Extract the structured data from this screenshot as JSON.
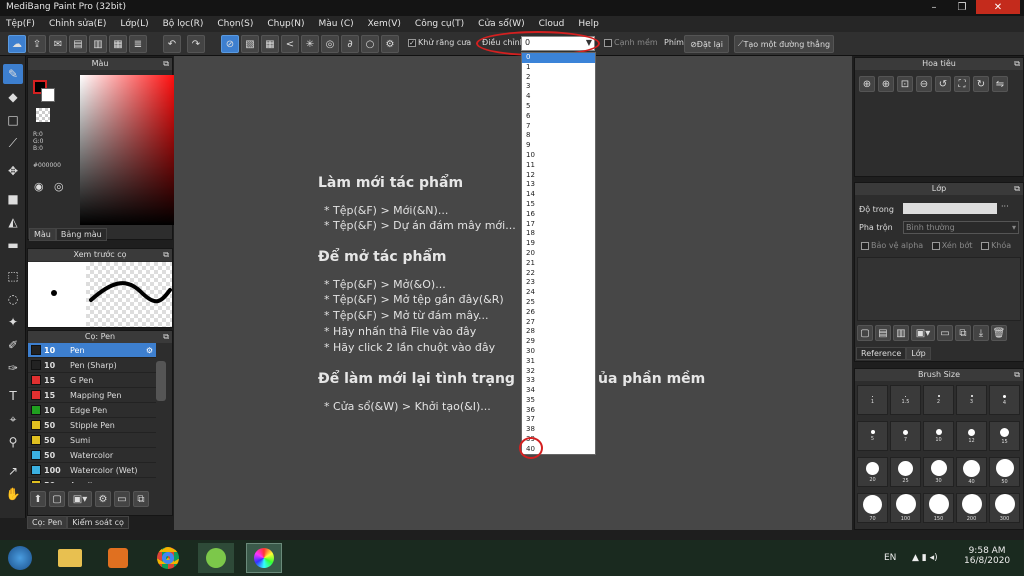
{
  "app": {
    "title": "MediBang Paint Pro (32bit)"
  },
  "window_buttons": {
    "minimize": "–",
    "maximize": "❐",
    "close": "✕"
  },
  "menu": [
    "Tệp(F)",
    "Chỉnh sửa(E)",
    "Lớp(L)",
    "Bộ lọc(R)",
    "Chọn(S)",
    "Chụp(N)",
    "Màu (C)",
    "Xem(V)",
    "Công cụ(T)",
    "Cửa sổ(W)",
    "Cloud",
    "Help"
  ],
  "toolbar": {
    "antialias": "Khử răng cưa",
    "adjust_label": "Điều chỉnh",
    "adjust_value": "0",
    "edge": "Cạnh mềm",
    "ruler": "Phím",
    "unset": "Đặt lại",
    "create_parallel": "Tạo một đường thẳng"
  },
  "dropdown": {
    "options": [
      "0",
      "1",
      "2",
      "3",
      "4",
      "5",
      "6",
      "7",
      "8",
      "9",
      "10",
      "11",
      "12",
      "13",
      "14",
      "15",
      "16",
      "17",
      "18",
      "19",
      "20",
      "21",
      "22",
      "23",
      "24",
      "25",
      "26",
      "27",
      "28",
      "29",
      "30",
      "31",
      "32",
      "33",
      "34",
      "35",
      "36",
      "37",
      "38",
      "39",
      "40"
    ]
  },
  "color_panel": {
    "title": "Màu",
    "r": "R:0",
    "g": "G:0",
    "b": "B:0",
    "hex": "#000000",
    "tab_color": "Màu",
    "tab_palette": "Bảng màu"
  },
  "preview_panel": {
    "title": "Xem trước cọ"
  },
  "brush_panel": {
    "title": "Cọ: Pen",
    "tab1": "Cọ: Pen",
    "tab2": "Kiểm soát cọ",
    "brushes": [
      {
        "size": "10",
        "name": "Pen",
        "color": "#222222",
        "selected": true
      },
      {
        "size": "10",
        "name": "Pen (Sharp)",
        "color": "#222222",
        "selected": false
      },
      {
        "size": "15",
        "name": "G Pen",
        "color": "#e03030",
        "selected": false
      },
      {
        "size": "15",
        "name": "Mapping Pen",
        "color": "#e03030",
        "selected": false
      },
      {
        "size": "10",
        "name": "Edge Pen",
        "color": "#20a020",
        "selected": false
      },
      {
        "size": "50",
        "name": "Stipple Pen",
        "color": "#e0c020",
        "selected": false
      },
      {
        "size": "50",
        "name": "Sumi",
        "color": "#e0c020",
        "selected": false
      },
      {
        "size": "50",
        "name": "Watercolor",
        "color": "#3bb0e0",
        "selected": false
      },
      {
        "size": "100",
        "name": "Watercolor (Wet)",
        "color": "#3bb0e0",
        "selected": false
      },
      {
        "size": "50",
        "name": "Acrylic",
        "color": "#e0c020",
        "selected": false
      }
    ]
  },
  "nav_panel": {
    "title": "Hoa tiêu"
  },
  "layer_panel": {
    "title": "Lớp",
    "opacity": "Độ trong",
    "blend": "Pha trộn",
    "blend_value": "Bình thường",
    "protect_alpha": "Bảo vệ alpha",
    "clipping": "Xén bớt",
    "lock": "Khóa",
    "tab_reference": "Reference",
    "tab_layer": "Lớp"
  },
  "brushsize_panel": {
    "title": "Brush Size",
    "sizes": [
      "1",
      "1.5",
      "2",
      "3",
      "4",
      "5",
      "7",
      "10",
      "12",
      "15",
      "20",
      "25",
      "30",
      "40",
      "50",
      "70",
      "100",
      "150",
      "200",
      "300"
    ]
  },
  "canvas_text": {
    "h1": "Làm mới tác phẩm",
    "l1": "* Tệp(&F) > Mới(&N)...",
    "l2": "* Tệp(&F) > Dự án đám mây mới...",
    "h2": "Để mở tác phẩm",
    "l3": "* Tệp(&F) > Mở(&O)...",
    "l4": "* Tệp(&F) > Mở tệp gần đây(&R)",
    "l5": "* Tệp(&F) > Mở từ đám mây...",
    "l6": "* Hãy nhấn thả File vào đây",
    "l7": "* Hãy click 2 lần chuột vào đây",
    "h3a": "Để làm mới lại tình trạng",
    "h3b": "ủa phần mềm",
    "l8": "* Cửa sổ(&W) > Khởi tạo(&I)..."
  },
  "taskbar": {
    "lang": "EN",
    "time": "9:58 AM",
    "date": "16/8/2020"
  }
}
